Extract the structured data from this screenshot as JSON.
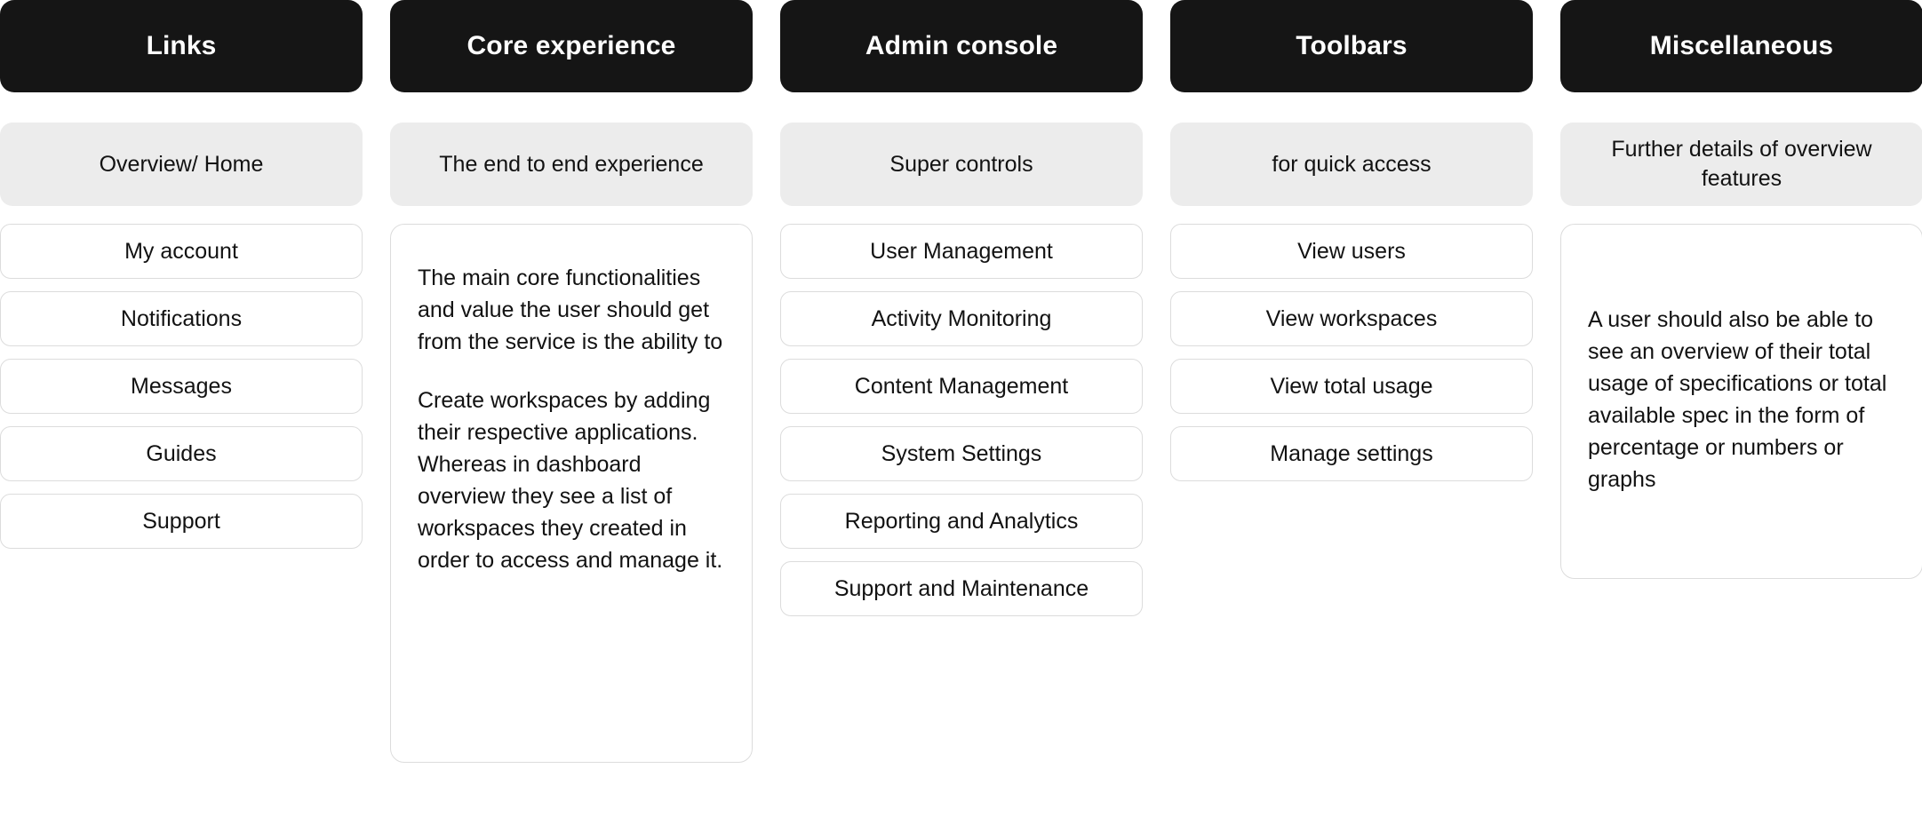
{
  "theme": {
    "header_bg": "#151515",
    "header_text": "#ffffff",
    "subtitle_bg": "#ECECEC",
    "item_border": "#DCDCDC",
    "page_bg": "#ffffff",
    "text": "#121212"
  },
  "columns": [
    {
      "title": "Links",
      "subtitle": "Overview/ Home",
      "type": "list",
      "items": [
        "My account",
        "Notifications",
        "Messages",
        "Guides",
        "Support"
      ]
    },
    {
      "title": "Core experience",
      "subtitle": "The end to end experience",
      "type": "note",
      "note_paragraphs": [
        "The main core functionalities and value the user should get from the service is the ability to",
        "Create workspaces by adding their respective applications. Whereas in dashboard overview they see a list of workspaces they created in order to access and manage it."
      ]
    },
    {
      "title": "Admin console",
      "subtitle": "Super controls",
      "type": "list",
      "items": [
        "User Management",
        "Activity Monitoring",
        "Content Management",
        "System Settings",
        "Reporting and Analytics",
        "Support and Maintenance"
      ]
    },
    {
      "title": "Toolbars",
      "subtitle": "for quick access",
      "type": "list",
      "items": [
        "View users",
        "View workspaces",
        "View total usage",
        "Manage settings"
      ]
    },
    {
      "title": "Miscellaneous",
      "subtitle": "Further details of overview features",
      "type": "note",
      "note_paragraphs": [
        "A user should also be able to see an overview of their total usage of specifications or total available spec in the form of percentage or numbers or graphs"
      ]
    }
  ]
}
